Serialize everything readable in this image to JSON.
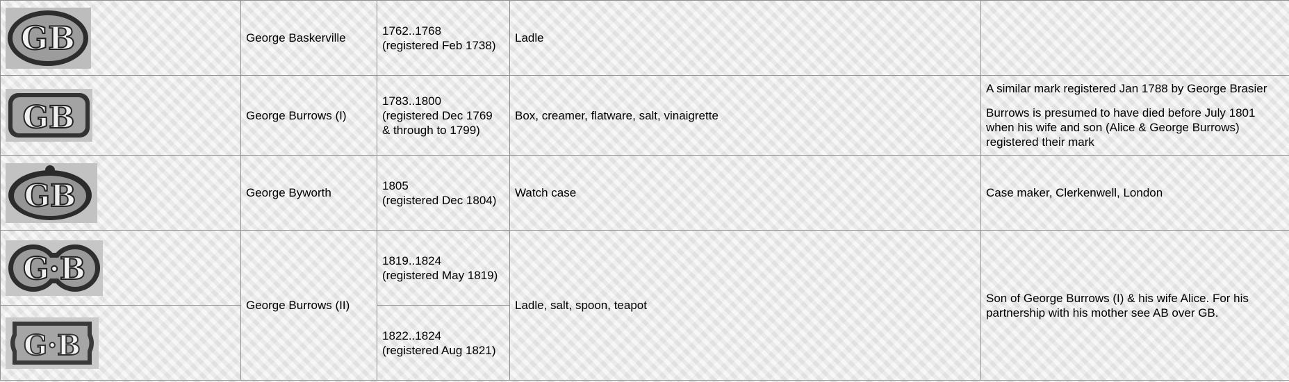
{
  "rows": [
    {
      "mark_icon": "hallmark-gb-oval-icon",
      "mark_letters": "GB",
      "maker": "George Baskerville",
      "dates": "1762..1768",
      "registered": "(registered Feb 1738)",
      "items": "Ladle",
      "notes": []
    },
    {
      "mark_icon": "hallmark-gb-rectangle-icon",
      "mark_letters": "GB",
      "maker": "George Burrows (I)",
      "dates": "1783..1800",
      "registered": "(registered Dec 1769",
      "registered_cont": "& through to 1799)",
      "items": "Box, creamer, flatware, salt, vinaigrette",
      "notes": [
        "A similar mark registered Jan 1788 by George Brasier",
        "Burrows is presumed to have died before July 1801 when his wife and son (Alice & George Burrows) registered their mark"
      ]
    },
    {
      "mark_icon": "hallmark-gb-crowned-oval-icon",
      "mark_letters": "GB",
      "maker": "George Byworth",
      "dates": "1805",
      "registered": "(registered Dec 1804)",
      "items": "Watch case",
      "notes": [
        "Case maker, Clerkenwell, London"
      ]
    },
    {
      "maker": "George Burrows (II)",
      "items": "Ladle, salt, spoon, teapot",
      "notes": [
        "Son of George Burrows (I) & his wife Alice. For his partnership with his mother see AB over GB."
      ],
      "sub": [
        {
          "mark_icon": "hallmark-g-dot-b-double-oval-icon",
          "mark_letters": "G·B",
          "dates": "1819..1824",
          "registered": "(registered May 1819)"
        },
        {
          "mark_icon": "hallmark-g-dot-b-shaped-rectangle-icon",
          "mark_letters": "G·B",
          "dates": "1822..1824",
          "registered": "(registered Aug 1821)"
        }
      ]
    }
  ]
}
